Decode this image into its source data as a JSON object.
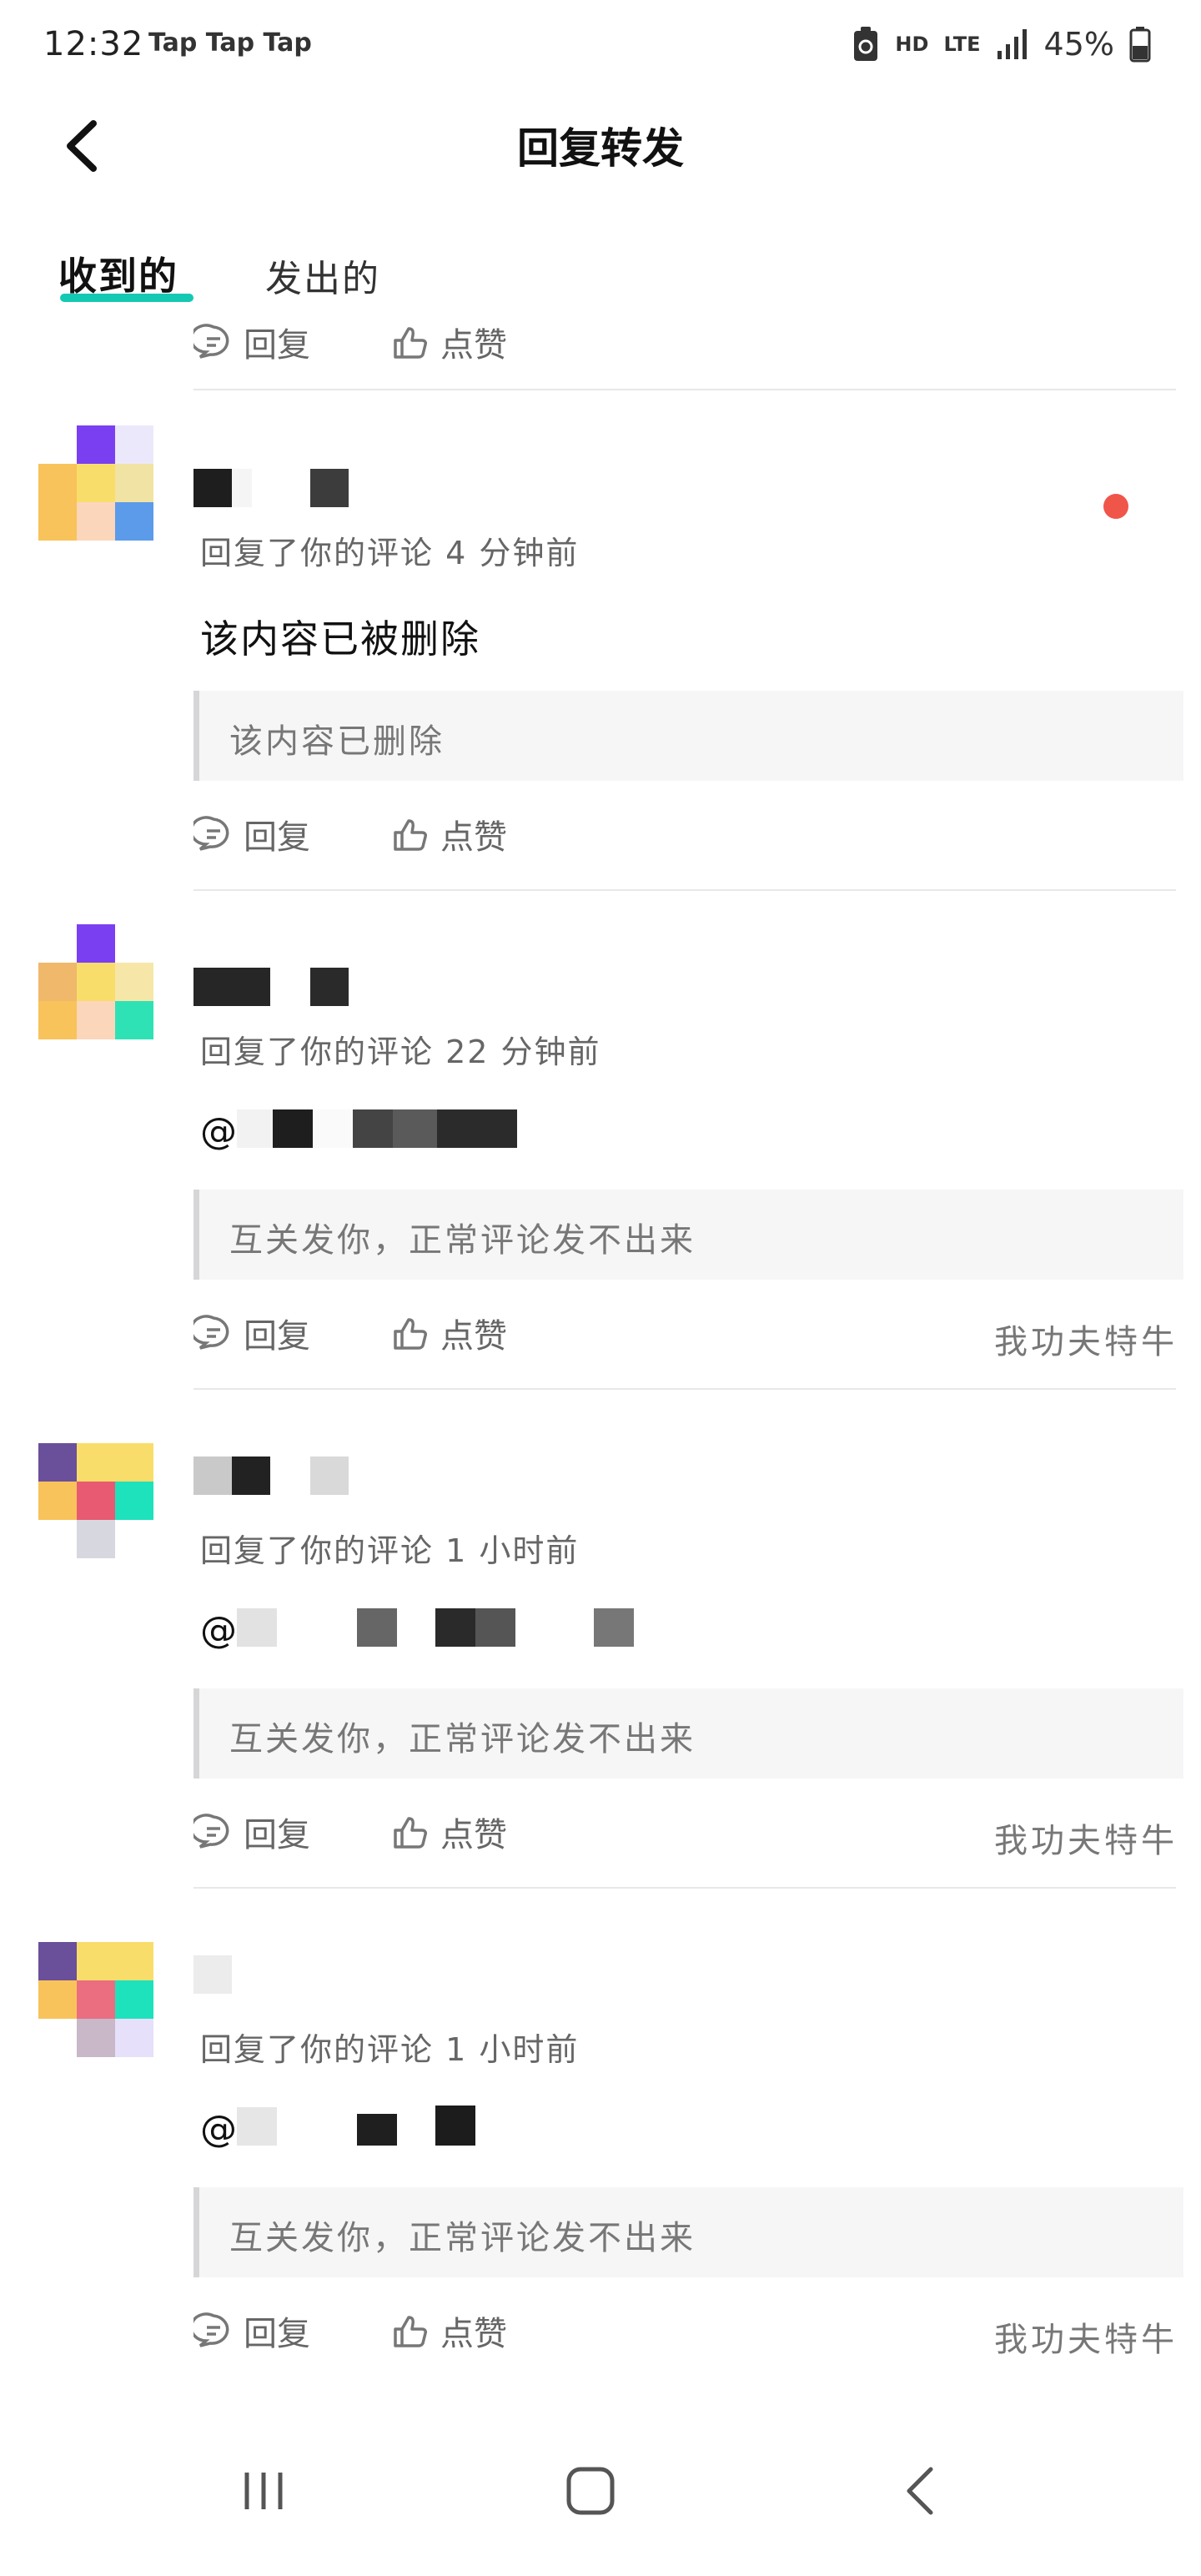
{
  "status_bar": {
    "time": "12:32",
    "app_name": "Tap Tap Tap",
    "network": "HD",
    "lte": "LTE",
    "battery": "45%"
  },
  "header": {
    "title": "回复转发"
  },
  "tabs": [
    {
      "label": "收到的",
      "active": true
    },
    {
      "label": "发出的",
      "active": false
    }
  ],
  "partial_top": {
    "reply_label": "回复",
    "like_label": "点赞"
  },
  "comments": [
    {
      "meta": "回复了你的评论 4 分钟前",
      "content": "该内容已被删除",
      "quote": "该内容已删除",
      "reply_label": "回复",
      "like_label": "点赞",
      "game": "",
      "unread": true
    },
    {
      "meta": "回复了你的评论 22 分钟前",
      "content": "@",
      "quote": "互关发你，正常评论发不出来",
      "reply_label": "回复",
      "like_label": "点赞",
      "game": "我功夫特牛",
      "unread": false
    },
    {
      "meta": "回复了你的评论 1 小时前",
      "content": "@",
      "quote": "互关发你，正常评论发不出来",
      "reply_label": "回复",
      "like_label": "点赞",
      "game": "我功夫特牛",
      "unread": false
    },
    {
      "meta": "回复了你的评论 1 小时前",
      "content": "@",
      "quote": "互关发你，正常评论发不出来",
      "reply_label": "回复",
      "like_label": "点赞",
      "game": "我功夫特牛",
      "unread": false
    }
  ],
  "colors": {
    "accent": "#14c9b4",
    "unread_dot": "#f0554a"
  }
}
